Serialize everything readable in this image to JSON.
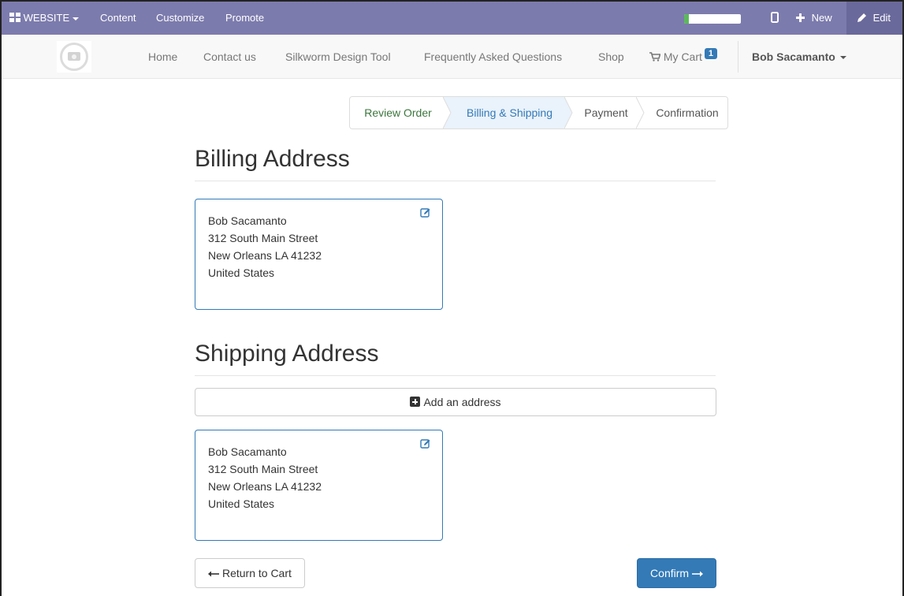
{
  "admin_bar": {
    "app_label": "WEBSITE",
    "menu": [
      "Content",
      "Customize",
      "Promote"
    ],
    "progress_fraction": 0.08,
    "new_label": "New",
    "edit_label": "Edit",
    "color": "#7c7bad"
  },
  "nav": {
    "links": [
      "Home",
      "Contact us",
      "Silkworm Design Tool",
      "Frequently Asked Questions",
      "Shop"
    ],
    "cart_label": "My Cart",
    "cart_count": "1",
    "user_name": "Bob Sacamanto"
  },
  "wizard": {
    "steps": [
      "Review Order",
      "Billing & Shipping",
      "Payment",
      "Confirmation"
    ],
    "active_step": "Billing & Shipping",
    "colors": {
      "done": "#3c763d",
      "active_text": "#337ab7",
      "active_bg": "#eaf2fb"
    }
  },
  "billing": {
    "heading": "Billing Address",
    "lines": [
      "Bob Sacamanto",
      "312 South Main Street",
      "New Orleans LA 41232",
      "United States"
    ]
  },
  "shipping": {
    "heading": "Shipping Address",
    "add_label": "Add an address",
    "lines": [
      "Bob Sacamanto",
      "312 South Main Street",
      "New Orleans LA 41232",
      "United States"
    ]
  },
  "actions": {
    "return_label": "Return to Cart",
    "confirm_label": "Confirm",
    "accent": "#337ab7"
  },
  "icons": {
    "apps": "grid-icon",
    "mobile": "mobile-icon",
    "new": "plus-icon",
    "edit": "pencil-icon",
    "cart": "cart-icon",
    "edit_address": "edit-square-icon",
    "add": "plus-square-icon",
    "back": "arrow-left-icon",
    "forward": "arrow-right-icon"
  }
}
